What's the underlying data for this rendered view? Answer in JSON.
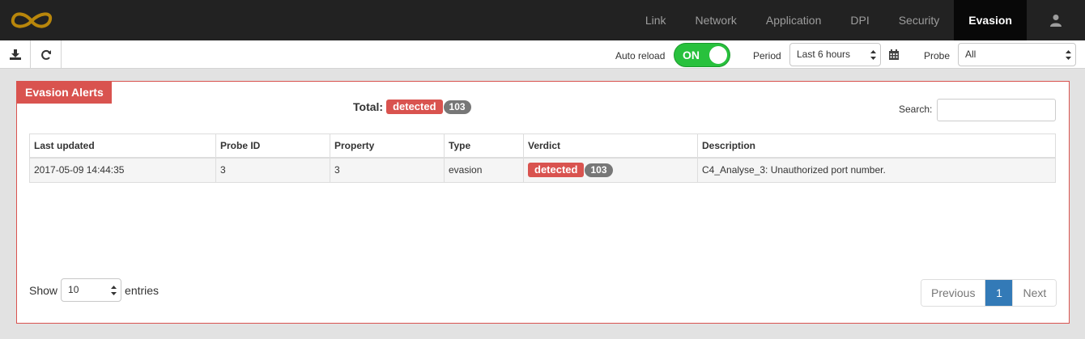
{
  "nav": {
    "items": [
      {
        "label": "Link",
        "name": "nav-item-link",
        "active": false
      },
      {
        "label": "Network",
        "name": "nav-item-network",
        "active": false
      },
      {
        "label": "Application",
        "name": "nav-item-application",
        "active": false
      },
      {
        "label": "DPI",
        "name": "nav-item-dpi",
        "active": false
      },
      {
        "label": "Security",
        "name": "nav-item-security",
        "active": false
      },
      {
        "label": "Evasion",
        "name": "nav-item-evasion",
        "active": true
      }
    ],
    "user_icon": "user-icon",
    "logo_icon": "infinity-logo"
  },
  "toolbar": {
    "download_icon": "download-icon",
    "refresh_icon": "refresh-icon",
    "auto_reload_label": "Auto reload",
    "toggle_state": "ON",
    "period_label": "Period",
    "period_value": "Last 6 hours",
    "calendar_icon": "calendar-icon",
    "probe_label": "Probe",
    "probe_value": "All"
  },
  "panel": {
    "title": "Evasion Alerts",
    "total_label": "Total:",
    "total_status": "detected",
    "total_count": "103",
    "search_label": "Search:",
    "columns": [
      "Last updated",
      "Probe ID",
      "Property",
      "Type",
      "Verdict",
      "Description"
    ],
    "rows": [
      {
        "last_updated": "2017-05-09 14:44:35",
        "probe_id": "3",
        "property": "3",
        "type": "evasion",
        "verdict": "detected",
        "verdict_count": "103",
        "description": "C4_Analyse_3: Unauthorized port number."
      }
    ],
    "show_label": "Show",
    "entries_value": "10",
    "entries_label": "entries",
    "pagination": {
      "previous": "Previous",
      "current": "1",
      "next": "Next"
    }
  },
  "colors": {
    "navbar": "#222222",
    "danger": "#d9534f",
    "toggle_on": "#28c13d",
    "page_active": "#337ab7"
  }
}
